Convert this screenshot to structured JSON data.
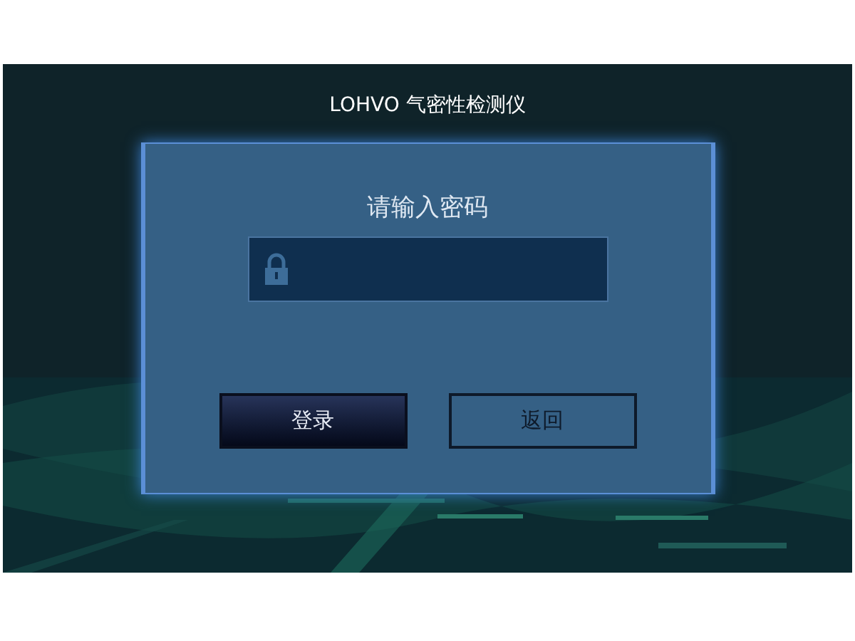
{
  "header": {
    "title": "LOHVO 气密性检测仪"
  },
  "dialog": {
    "prompt": "请输入密码",
    "buttons": [
      {
        "label": "登录",
        "kind": "primary"
      },
      {
        "label": "返回",
        "kind": "outline"
      }
    ]
  }
}
